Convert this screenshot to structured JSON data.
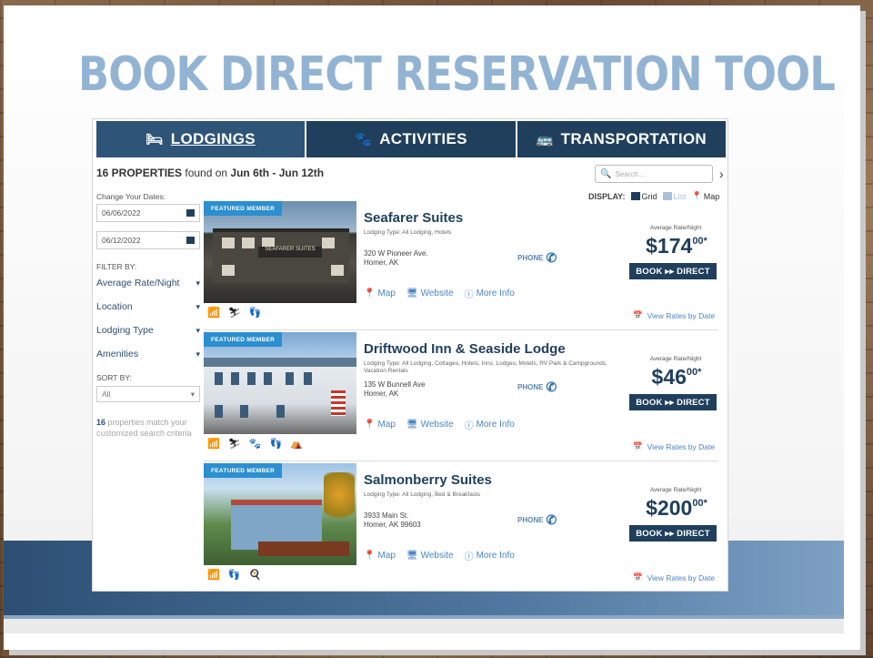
{
  "slide": {
    "title": "BOOK DIRECT RESERVATION TOOL"
  },
  "tabs": [
    {
      "label": "LODGINGS",
      "icon": "bed-icon",
      "active": true
    },
    {
      "label": "ACTIVITIES",
      "icon": "activities-icon",
      "active": false
    },
    {
      "label": "TRANSPORTATION",
      "icon": "transport-icon",
      "active": false
    }
  ],
  "results": {
    "count": "16 PROPERTIES",
    "found_text": " found on ",
    "dates": "Jun 6th - Jun 12th"
  },
  "search": {
    "placeholder": "Search..."
  },
  "display": {
    "label": "DISPLAY:",
    "grid": "Grid",
    "list": "List",
    "map": "Map"
  },
  "sidebar": {
    "change_dates": "Change Your Dates:",
    "start_date": "06/06/2022",
    "end_date": "06/12/2022",
    "filter_by": "FILTER BY:",
    "filters": [
      "Average Rate/Night",
      "Location",
      "Lodging Type",
      "Amenities"
    ],
    "sort_by": "SORT BY:",
    "sort_value": "All",
    "match_count": "16",
    "match_text": " properties match your customized search criteria"
  },
  "listings": [
    {
      "badge": "FEATURED MEMBER",
      "name": "Seafarer Suites",
      "type": "Lodging Type: All Lodging, Hotels",
      "addr1": "320 W Pioneer Ave.",
      "addr2": "Homer, AK",
      "phone": "PHONE",
      "rate_label": "Average Rate/Night",
      "price_main": "$174",
      "price_cents": "00*",
      "book": "BOOK ▸▸ DIRECT",
      "links": [
        "Map",
        "Website",
        "More Info"
      ],
      "view_rates": "View Rates by Date",
      "amenities": "📶 ⛷ 👣"
    },
    {
      "badge": "FEATURED MEMBER",
      "name": "Driftwood Inn & Seaside Lodge",
      "type": "Lodging Type: All Lodging, Cottages, Hotels, Inns, Lodges, Motels, RV Park & Campgrounds, Vacation Rentals",
      "addr1": "135 W Bunnell Ave",
      "addr2": "Homer, AK",
      "phone": "PHONE",
      "rate_label": "Average Rate/Night",
      "price_main": "$46",
      "price_cents": "00*",
      "book": "BOOK ▸▸ DIRECT",
      "links": [
        "Map",
        "Website",
        "More Info"
      ],
      "view_rates": "View Rates by Date",
      "amenities": "📶 ⛷ 🐾 👣 ⛺"
    },
    {
      "badge": "FEATURED MEMBER",
      "name": "Salmonberry Suites",
      "type": "Lodging Type: All Lodging, Bed & Breakfasts",
      "addr1": "3933 Main St.",
      "addr2": "Homer, AK 99603",
      "phone": "PHONE",
      "rate_label": "Average Rate/Night",
      "price_main": "$200",
      "price_cents": "00*",
      "book": "BOOK ▸▸ DIRECT",
      "links": [
        "Map",
        "Website",
        "More Info"
      ],
      "view_rates": "View Rates by Date",
      "amenities": "📶 👣 🍳"
    }
  ],
  "colors": {
    "navy": "#1f3f5c",
    "accent_blue": "#2b8fd0",
    "title_blue": "#93b3d3"
  }
}
